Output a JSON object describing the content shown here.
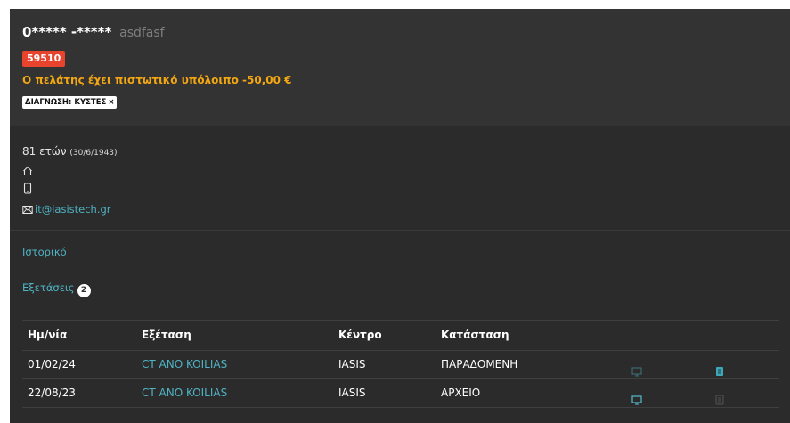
{
  "patient": {
    "name": "0***** -*****",
    "alt_name": "asdfasf",
    "id_badge": "59510",
    "credit_message": "Ο πελάτης έχει πιστωτικό υπόλοιπο -50,00 €",
    "diagnosis_tag": "ΔΙΑΓΝΩΣΗ: ΚΥΣΤΕΣ",
    "diagnosis_remove": "×",
    "age": "81 ετών",
    "birthdate": "(30/6/1943)",
    "email": "it@iasistech.gr"
  },
  "links": {
    "history": "Ιστορικό",
    "exams": "Εξετάσεις",
    "exams_count": "2"
  },
  "table": {
    "headers": {
      "date": "Ημ/νία",
      "exam": "Εξέταση",
      "center": "Κέντρο",
      "status": "Κατάσταση"
    },
    "rows": [
      {
        "date": "01/02/24",
        "exam": "CT ANO KOILIAS",
        "center": "IASIS",
        "status": "ΠΑΡΑΔΟΜΕΝΗ"
      },
      {
        "date": "22/08/23",
        "exam": "CT ANO KOILIAS",
        "center": "IASIS",
        "status": "ΑΡΧΕΙΟ"
      }
    ]
  },
  "colors": {
    "accent": "#4fb3c4",
    "badge": "#e8432d",
    "warning": "#f3a712",
    "background": "#2b2b2b"
  },
  "icons": {
    "home": "home-icon",
    "phone": "mobile-phone-icon",
    "email": "envelope-icon",
    "viewer": "monitor-icon",
    "report": "document-icon"
  }
}
